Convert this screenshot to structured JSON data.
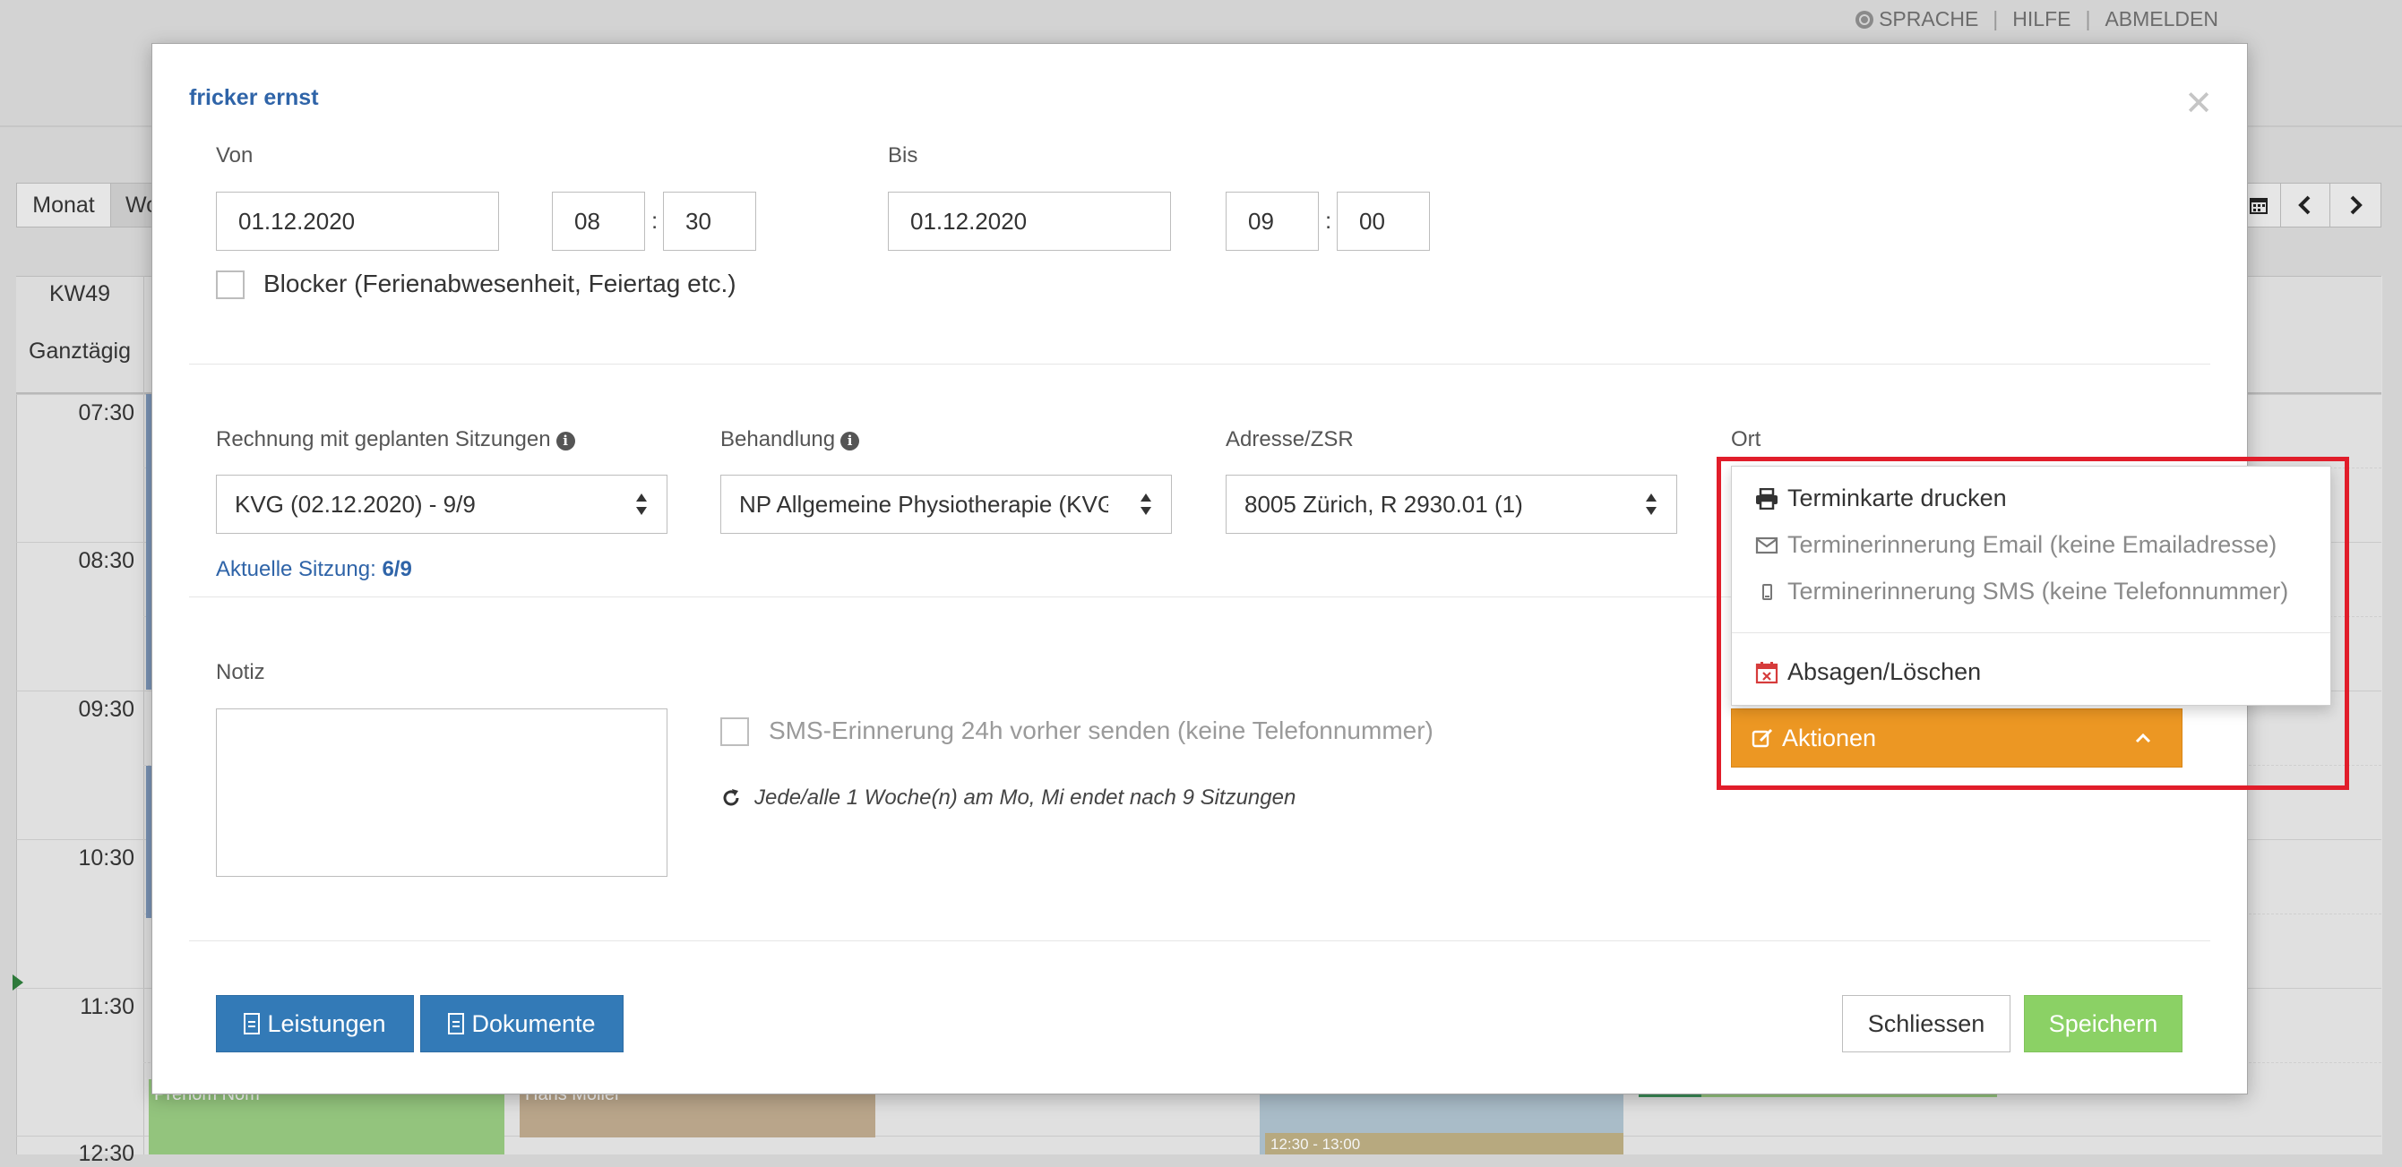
{
  "topnav": {
    "language": "SPRACHE",
    "help": "HILFE",
    "logout": "ABMELDEN"
  },
  "background": {
    "view_month": "Monat",
    "view_week": "Wo",
    "week_label": "KW49",
    "allday_label": "Ganztägig",
    "hours": [
      "07:30",
      "08:30",
      "09:30",
      "10:30",
      "11:30",
      "12:30"
    ],
    "events": [
      {
        "label": "Prénom Nom",
        "color": "#93c47d"
      },
      {
        "label": "Hans Möller",
        "color": "#b9a58a"
      },
      {
        "label": "12:30 - 13:00",
        "color": "#b7a97f"
      }
    ]
  },
  "modal": {
    "title": "fricker ernst",
    "from_label": "Von",
    "from_date": "01.12.2020",
    "from_hour": "08",
    "from_minute": "30",
    "to_label": "Bis",
    "to_date": "01.12.2020",
    "to_hour": "09",
    "to_minute": "00",
    "time_separator": ":",
    "blocker_label": "Blocker (Ferienabwesenheit, Feiertag etc.)",
    "invoice_label": "Rechnung mit geplanten Sitzungen",
    "invoice_value": "KVG (02.12.2020) - 9/9",
    "treatment_label": "Behandlung",
    "treatment_value": "NP Allgemeine Physiotherapie (KVG)",
    "address_label": "Adresse/ZSR",
    "address_value": "8005 Zürich, R 2930.01 (1)",
    "location_label": "Ort",
    "session_prefix": "Aktuelle Sitzung:",
    "session_value": "6/9",
    "note_label": "Notiz",
    "sms_label": "SMS-Erinnerung 24h vorher senden (keine Telefonnummer)",
    "recurrence": "Jede/alle 1 Woche(n) am Mo, Mi endet nach 9 Sitzungen",
    "btn_services": "Leistungen",
    "btn_documents": "Dokumente",
    "btn_close": "Schliessen",
    "btn_save": "Speichern",
    "btn_actions": "Aktionen",
    "actions_menu": {
      "print": "Terminkarte drucken",
      "email": "Terminerinnerung Email (keine Emailadresse)",
      "sms": "Terminerinnerung SMS (keine Telefonnummer)",
      "cancel": "Absagen/Löschen"
    }
  },
  "colors": {
    "primary": "#337ab7",
    "success": "#8bd165",
    "warning": "#ec9723",
    "title": "#2f64a8",
    "highlight": "#e11d2a"
  }
}
